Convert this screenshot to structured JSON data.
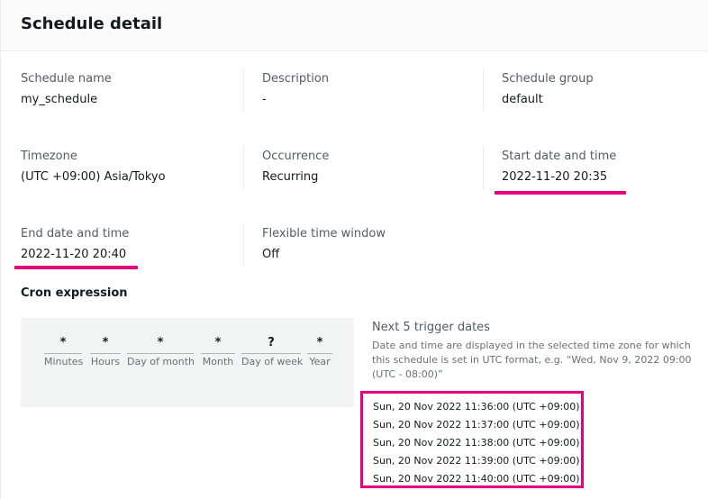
{
  "header": {
    "title": "Schedule detail"
  },
  "details": {
    "schedule_name": {
      "label": "Schedule name",
      "value": "my_schedule"
    },
    "description": {
      "label": "Description",
      "value": "-"
    },
    "schedule_group": {
      "label": "Schedule group",
      "value": "default"
    },
    "timezone": {
      "label": "Timezone",
      "value": "(UTC +09:00) Asia/Tokyo"
    },
    "occurrence": {
      "label": "Occurrence",
      "value": "Recurring"
    },
    "start": {
      "label": "Start date and time",
      "value": "2022-11-20 20:35"
    },
    "end": {
      "label": "End date and time",
      "value": "2022-11-20 20:40"
    },
    "flexible": {
      "label": "Flexible time window",
      "value": "Off"
    }
  },
  "cron": {
    "title": "Cron expression",
    "fields": [
      {
        "value": "*",
        "label": "Minutes"
      },
      {
        "value": "*",
        "label": "Hours"
      },
      {
        "value": "*",
        "label": "Day of month"
      },
      {
        "value": "*",
        "label": "Month"
      },
      {
        "value": "?",
        "label": "Day of week"
      },
      {
        "value": "*",
        "label": "Year"
      }
    ]
  },
  "next": {
    "title": "Next 5 trigger dates",
    "description": "Date and time are displayed in the selected time zone for which this schedule is set in UTC format, e.g. “Wed, Nov 9, 2022 09:00 (UTC - 08:00)”",
    "dates": [
      "Sun, 20 Nov 2022 11:36:00 (UTC +09:00)",
      "Sun, 20 Nov 2022 11:37:00 (UTC +09:00)",
      "Sun, 20 Nov 2022 11:38:00 (UTC +09:00)",
      "Sun, 20 Nov 2022 11:39:00 (UTC +09:00)",
      "Sun, 20 Nov 2022 11:40:00 (UTC +09:00)"
    ]
  },
  "colors": {
    "highlight": "#e6007e",
    "cron_bg": "#f2f3f3"
  }
}
